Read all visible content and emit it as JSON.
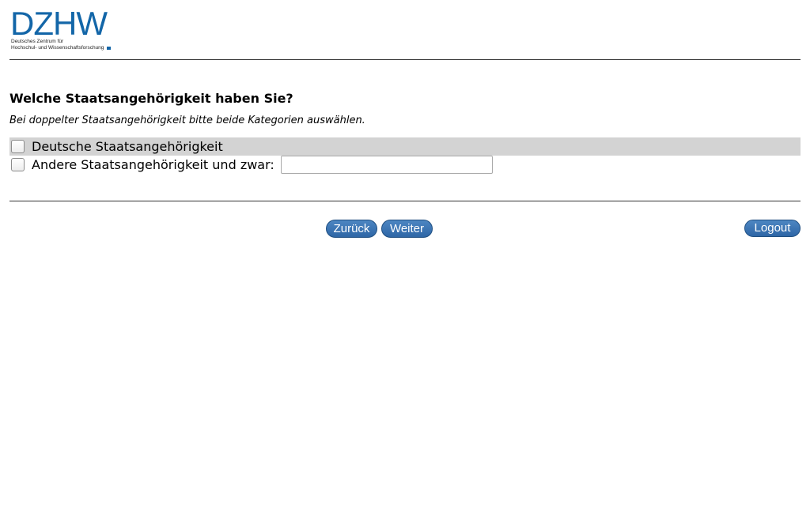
{
  "logo": {
    "wordmark": "DZHW",
    "line1": "Deutsches Zentrum für",
    "line2": "Hochschul- und Wissenschaftsforschung",
    "brand_color": "#1366a8"
  },
  "question": {
    "title": "Welche Staatsangehörigkeit haben Sie?",
    "hint": "Bei doppelter Staatsangehörigkeit bitte beide Kategorien auswählen.",
    "options": [
      {
        "label": "Deutsche Staatsangehörigkeit",
        "checked": false,
        "highlighted": true
      },
      {
        "label": "Andere Staatsangehörigkeit und zwar:",
        "checked": false,
        "highlighted": false
      }
    ],
    "other_input_value": "",
    "other_input_placeholder": ""
  },
  "navigation": {
    "back_label": "Zurück",
    "next_label": "Weiter",
    "logout_label": "Logout",
    "button_color": "#3a72b0"
  }
}
